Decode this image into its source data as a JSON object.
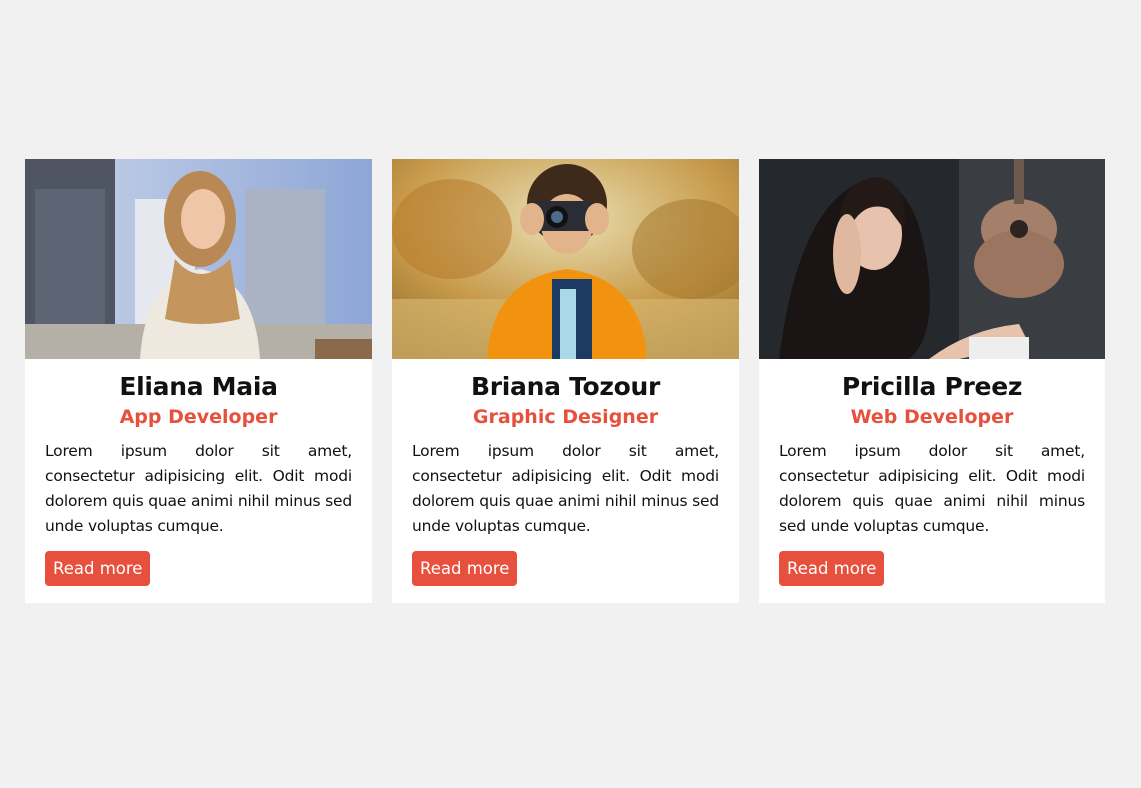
{
  "cards": [
    {
      "name": "Eliana Maia",
      "role": "App Developer",
      "description": "Lorem ipsum dolor sit amet, consectetur adipisicing elit. Odit modi dolorem quis quae animi nihil minus sed unde voluptas cumque.",
      "button": "Read more",
      "photo_subject": "woman-on-phone-city"
    },
    {
      "name": "Briana Tozour",
      "role": "Graphic Designer",
      "description": "Lorem ipsum dolor sit amet, consectetur adipisicing elit. Odit modi dolorem quis quae animi nihil minus sed unde voluptas cumque.",
      "button": "Read more",
      "photo_subject": "child-with-camera-field"
    },
    {
      "name": "Pricilla Preez",
      "role": "Web Developer",
      "description": "Lorem ipsum dolor sit amet, consectetur adipisicing elit. Odit modi dolorem quis quae animi nihil minus sed unde voluptas cumque.",
      "button": "Read more",
      "photo_subject": "woman-with-coffee-guitar"
    }
  ],
  "colors": {
    "accent": "#e8503e",
    "background": "#f1f1f1",
    "card": "#ffffff"
  }
}
